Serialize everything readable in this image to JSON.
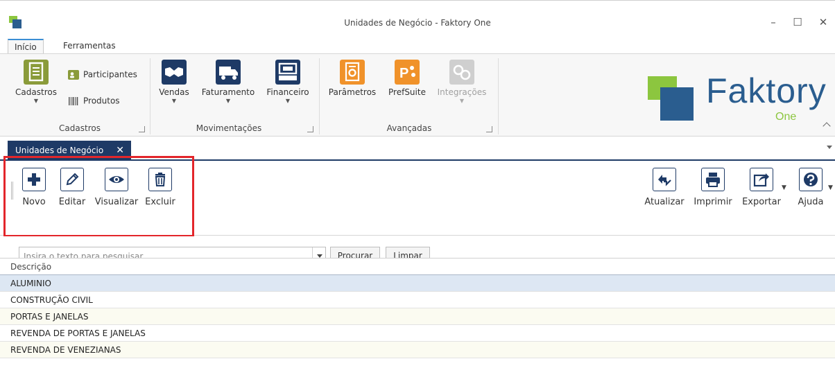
{
  "window": {
    "title": "Unidades de Negócio - Faktory One",
    "minimize": "–",
    "maximize": "☐",
    "close": "✕"
  },
  "ribbon_tabs": [
    "Início",
    "Ferramentas"
  ],
  "ribbon": {
    "groups": {
      "cadastros": {
        "label": "Cadastros",
        "big_button": "Cadastros",
        "participantes": "Participantes",
        "produtos": "Produtos"
      },
      "movimentacoes": {
        "label": "Movimentações",
        "vendas": "Vendas",
        "faturamento": "Faturamento",
        "financeiro": "Financeiro"
      },
      "avancadas": {
        "label": "Avançadas",
        "parametros": "Parâmetros",
        "prefsuite": "PrefSuite",
        "integracoes": "Integrações"
      }
    },
    "logo": {
      "text": "Faktory",
      "sub": "One"
    }
  },
  "doc_tab": {
    "label": "Unidades de Negócio",
    "close": "✕"
  },
  "toolbar": {
    "left": {
      "novo": "Novo",
      "editar": "Editar",
      "visualizar": "Visualizar",
      "excluir": "Excluir"
    },
    "right": {
      "atualizar": "Atualizar",
      "imprimir": "Imprimir",
      "exportar": "Exportar",
      "ajuda": "Ajuda"
    }
  },
  "search": {
    "placeholder": "Insira o texto para pesquisar...",
    "procurar": "Procurar",
    "limpar": "Limpar"
  },
  "grid": {
    "column": "Descrição",
    "rows": [
      "ALUMINIO",
      "CONSTRUÇÃO CIVIL",
      "PORTAS E JANELAS",
      "REVENDA DE PORTAS E JANELAS",
      "REVENDA DE VENEZIANAS"
    ]
  },
  "colors": {
    "accent_navy": "#1e3a66",
    "highlight_red": "#e3262b",
    "logo_green": "#8cc63f",
    "logo_blue": "#2a5d8f"
  }
}
